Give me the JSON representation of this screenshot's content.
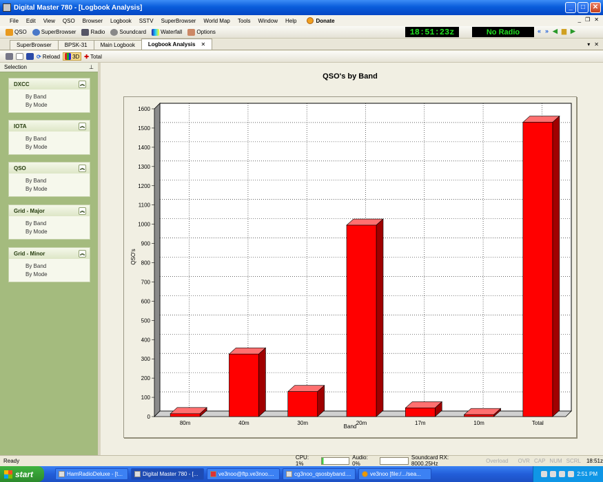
{
  "window": {
    "title": "Digital Master 780 - [Logbook Analysis]"
  },
  "menu": [
    "File",
    "Edit",
    "View",
    "QSO",
    "Browser",
    "Logbook",
    "SSTV",
    "SuperBrowser",
    "World Map",
    "Tools",
    "Window",
    "Help"
  ],
  "menu_donate": "Donate",
  "toolbar": {
    "qso": "QSO",
    "superbrowser": "SuperBrowser",
    "radio": "Radio",
    "soundcard": "Soundcard",
    "waterfall": "Waterfall",
    "options": "Options"
  },
  "clock": "18:51:23z",
  "radio_status": "No Radio",
  "tabs": [
    "SuperBrowser",
    "BPSK-31",
    "Main Logbook",
    "Logbook Analysis"
  ],
  "subtoolbar": {
    "reload": "Reload",
    "three_d": "3D",
    "total": "Total"
  },
  "sidebar": {
    "title": "Selection",
    "panels": [
      {
        "title": "DXCC",
        "items": [
          "By Band",
          "By Mode"
        ]
      },
      {
        "title": "IOTA",
        "items": [
          "By Band",
          "By Mode"
        ]
      },
      {
        "title": "QSO",
        "items": [
          "By Band",
          "By Mode"
        ]
      },
      {
        "title": "Grid - Major",
        "items": [
          "By Band",
          "By Mode"
        ]
      },
      {
        "title": "Grid - Minor",
        "items": [
          "By Band",
          "By Mode"
        ]
      }
    ]
  },
  "chart_data": {
    "type": "bar",
    "title": "QSO's by Band",
    "xlabel": "Band",
    "ylabel": "QSO's",
    "categories": [
      "80m",
      "40m",
      "30m",
      "20m",
      "17m",
      "10m",
      "Total"
    ],
    "values": [
      15,
      325,
      130,
      995,
      45,
      10,
      1530
    ],
    "ylim": [
      0,
      1600
    ],
    "yticks": [
      0,
      100,
      200,
      300,
      400,
      500,
      600,
      700,
      800,
      900,
      1000,
      1100,
      1200,
      1300,
      1400,
      1500,
      1600
    ],
    "grid": true,
    "three_d": true,
    "colors": {
      "front": "#ff0000",
      "top": "#ff7070",
      "side": "#a00000"
    }
  },
  "status": {
    "left": "Ready",
    "cpu": "CPU: 1%",
    "audio": "Audio: 0%",
    "soundcard": "Soundcard RX: 8000.25Hz",
    "overload": "Overload",
    "flags": [
      "OVR",
      "CAP",
      "NUM",
      "SCRL"
    ],
    "time": "18:51z"
  },
  "taskbar": {
    "start": "start",
    "tasks": [
      "HamRadioDeluxe - [t...",
      "Digital Master 780 - [...",
      "ve3noo@ftp.ve3noo....",
      "cg3noo_qsosbyband....",
      "ve3noo [file:/.../sea..."
    ],
    "tray_time": "2:51 PM"
  }
}
